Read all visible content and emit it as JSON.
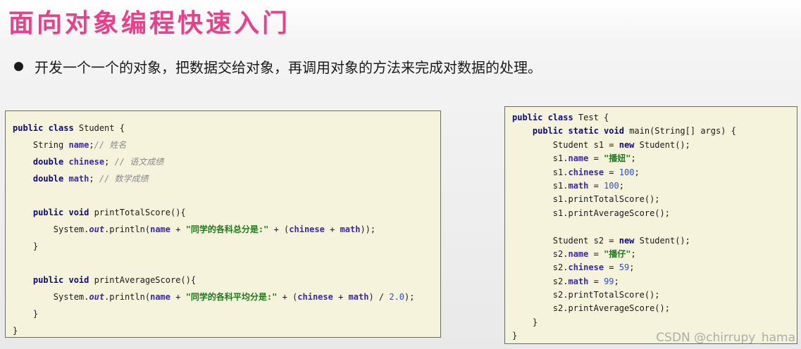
{
  "slide": {
    "title": "面向对象编程快速入门",
    "bullet": "开发一个一个的对象，把数据交给对象，再调用对象的方法来完成对数据的处理。"
  },
  "code": {
    "student_class": [
      [
        {
          "t": "public class ",
          "c": "kw"
        },
        {
          "t": "Student {",
          "c": ""
        }
      ],
      [
        {
          "t": "    String ",
          "c": ""
        },
        {
          "t": "name",
          "c": "fld"
        },
        {
          "t": ";",
          "c": ""
        },
        {
          "t": "// 姓名",
          "c": "cmt"
        }
      ],
      [
        {
          "t": "    ",
          "c": ""
        },
        {
          "t": "double ",
          "c": "kw"
        },
        {
          "t": "chinese",
          "c": "fld"
        },
        {
          "t": "; ",
          "c": ""
        },
        {
          "t": "// 语文成绩",
          "c": "cmt"
        }
      ],
      [
        {
          "t": "    ",
          "c": ""
        },
        {
          "t": "double ",
          "c": "kw"
        },
        {
          "t": "math",
          "c": "fld"
        },
        {
          "t": "; ",
          "c": ""
        },
        {
          "t": "// 数学成绩",
          "c": "cmt"
        }
      ],
      [],
      [
        {
          "t": "    ",
          "c": ""
        },
        {
          "t": "public void ",
          "c": "kw"
        },
        {
          "t": "printTotalScore(){",
          "c": ""
        }
      ],
      [
        {
          "t": "        System.",
          "c": ""
        },
        {
          "t": "out",
          "c": "stat"
        },
        {
          "t": ".println(",
          "c": ""
        },
        {
          "t": "name",
          "c": "fld"
        },
        {
          "t": " + ",
          "c": ""
        },
        {
          "t": "\"同学的各科总分是:\"",
          "c": "str"
        },
        {
          "t": " + (",
          "c": ""
        },
        {
          "t": "chinese",
          "c": "fld"
        },
        {
          "t": " + ",
          "c": ""
        },
        {
          "t": "math",
          "c": "fld"
        },
        {
          "t": "));",
          "c": ""
        }
      ],
      [
        {
          "t": "    }",
          "c": ""
        }
      ],
      [],
      [
        {
          "t": "    ",
          "c": ""
        },
        {
          "t": "public void ",
          "c": "kw"
        },
        {
          "t": "printAverageScore(){",
          "c": ""
        }
      ],
      [
        {
          "t": "        System.",
          "c": ""
        },
        {
          "t": "out",
          "c": "stat"
        },
        {
          "t": ".println(",
          "c": ""
        },
        {
          "t": "name",
          "c": "fld"
        },
        {
          "t": " + ",
          "c": ""
        },
        {
          "t": "\"同学的各科平均分是:\"",
          "c": "str"
        },
        {
          "t": " + (",
          "c": ""
        },
        {
          "t": "chinese",
          "c": "fld"
        },
        {
          "t": " + ",
          "c": ""
        },
        {
          "t": "math",
          "c": "fld"
        },
        {
          "t": ") / ",
          "c": ""
        },
        {
          "t": "2.0",
          "c": "num"
        },
        {
          "t": ");",
          "c": ""
        }
      ],
      [
        {
          "t": "    }",
          "c": ""
        }
      ],
      [
        {
          "t": "}",
          "c": ""
        }
      ]
    ],
    "test_class": [
      [
        {
          "t": "public class ",
          "c": "kw"
        },
        {
          "t": "Test {",
          "c": ""
        }
      ],
      [
        {
          "t": "    ",
          "c": ""
        },
        {
          "t": "public static void ",
          "c": "kw"
        },
        {
          "t": "main(String[] args) {",
          "c": ""
        }
      ],
      [
        {
          "t": "        Student s1 = ",
          "c": ""
        },
        {
          "t": "new ",
          "c": "kw"
        },
        {
          "t": "Student();",
          "c": ""
        }
      ],
      [
        {
          "t": "        s1.",
          "c": ""
        },
        {
          "t": "name",
          "c": "fld"
        },
        {
          "t": " = ",
          "c": ""
        },
        {
          "t": "\"播妞\"",
          "c": "str"
        },
        {
          "t": ";",
          "c": ""
        }
      ],
      [
        {
          "t": "        s1.",
          "c": ""
        },
        {
          "t": "chinese",
          "c": "fld"
        },
        {
          "t": " = ",
          "c": ""
        },
        {
          "t": "100",
          "c": "num"
        },
        {
          "t": ";",
          "c": ""
        }
      ],
      [
        {
          "t": "        s1.",
          "c": ""
        },
        {
          "t": "math",
          "c": "fld"
        },
        {
          "t": " = ",
          "c": ""
        },
        {
          "t": "100",
          "c": "num"
        },
        {
          "t": ";",
          "c": ""
        }
      ],
      [
        {
          "t": "        s1.printTotalScore();",
          "c": ""
        }
      ],
      [
        {
          "t": "        s1.printAverageScore();",
          "c": ""
        }
      ],
      [],
      [
        {
          "t": "        Student s2 = ",
          "c": ""
        },
        {
          "t": "new ",
          "c": "kw"
        },
        {
          "t": "Student();",
          "c": ""
        }
      ],
      [
        {
          "t": "        s2.",
          "c": ""
        },
        {
          "t": "name",
          "c": "fld"
        },
        {
          "t": " = ",
          "c": ""
        },
        {
          "t": "\"播仔\"",
          "c": "str"
        },
        {
          "t": ";",
          "c": ""
        }
      ],
      [
        {
          "t": "        s2.",
          "c": ""
        },
        {
          "t": "chinese",
          "c": "fld"
        },
        {
          "t": " = ",
          "c": ""
        },
        {
          "t": "59",
          "c": "num"
        },
        {
          "t": ";",
          "c": ""
        }
      ],
      [
        {
          "t": "        s2.",
          "c": ""
        },
        {
          "t": "math",
          "c": "fld"
        },
        {
          "t": " = ",
          "c": ""
        },
        {
          "t": "99",
          "c": "num"
        },
        {
          "t": ";",
          "c": ""
        }
      ],
      [
        {
          "t": "        s2.printTotalScore();",
          "c": ""
        }
      ],
      [
        {
          "t": "        s2.printAverageScore();",
          "c": ""
        }
      ],
      [
        {
          "t": "    }",
          "c": ""
        }
      ],
      [
        {
          "t": "}",
          "c": ""
        }
      ]
    ]
  },
  "watermark": "CSDN @chirrupy_hama",
  "colors": {
    "title": "#e8418b",
    "code_background": "#f6f3dc",
    "keyword": "#0d0b7a",
    "field": "#3a2aa6",
    "string": "#1f7a1f",
    "number": "#2c4bd8",
    "comment": "#8a8a8a"
  }
}
